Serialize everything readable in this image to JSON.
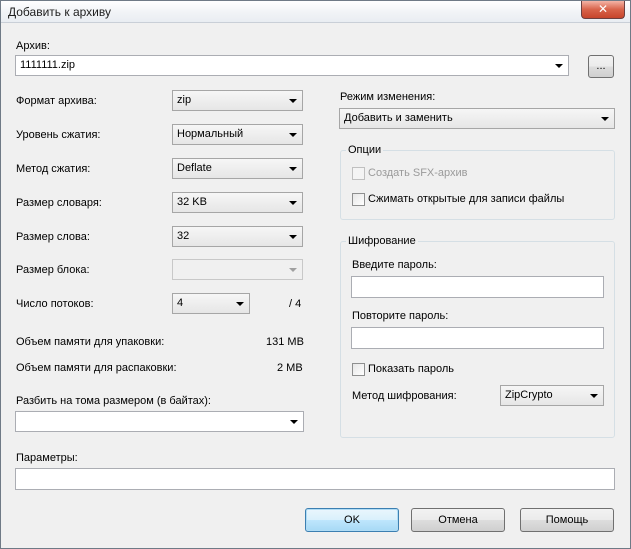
{
  "window": {
    "title": "Добавить к архиву",
    "close_glyph": "✕"
  },
  "archive": {
    "label": "Архив:",
    "value": "1111111.zip",
    "browse_label": "..."
  },
  "format": {
    "label": "Формат архива:",
    "value": "zip"
  },
  "compression_level": {
    "label": "Уровень сжатия:",
    "value": "Нормальный"
  },
  "compression_method": {
    "label": "Метод сжатия:",
    "value": "Deflate"
  },
  "dictionary_size": {
    "label": "Размер словаря:",
    "value": "32 KB"
  },
  "word_size": {
    "label": "Размер слова:",
    "value": "32"
  },
  "block_size": {
    "label": "Размер блока:",
    "value": ""
  },
  "threads": {
    "label": "Число потоков:",
    "value": "4",
    "max": "/ 4"
  },
  "memory": {
    "pack_label": "Объем памяти для упаковки:",
    "pack_value": "131 MB",
    "unpack_label": "Объем памяти для распаковки:",
    "unpack_value": "2 MB"
  },
  "split": {
    "label": "Разбить на тома размером (в байтах):",
    "value": ""
  },
  "parameters": {
    "label": "Параметры:",
    "value": ""
  },
  "update_mode": {
    "label": "Режим изменения:",
    "value": "Добавить и заменить"
  },
  "options": {
    "title": "Опции",
    "create_sfx": {
      "label": "Создать SFX-архив",
      "checked": false,
      "enabled": false
    },
    "compress_open": {
      "label": "Сжимать открытые для записи файлы",
      "checked": false
    }
  },
  "encryption": {
    "title": "Шифрование",
    "password_label": "Введите пароль:",
    "password_value": "",
    "repeat_label": "Повторите пароль:",
    "repeat_value": "",
    "show_password": {
      "label": "Показать пароль",
      "checked": false
    },
    "method_label": "Метод шифрования:",
    "method_value": "ZipCrypto"
  },
  "buttons": {
    "ok": "OK",
    "cancel": "Отмена",
    "help": "Помощь"
  },
  "colors": {
    "default_button_border": "#3c7fb1",
    "close_button": "#c7442b"
  }
}
